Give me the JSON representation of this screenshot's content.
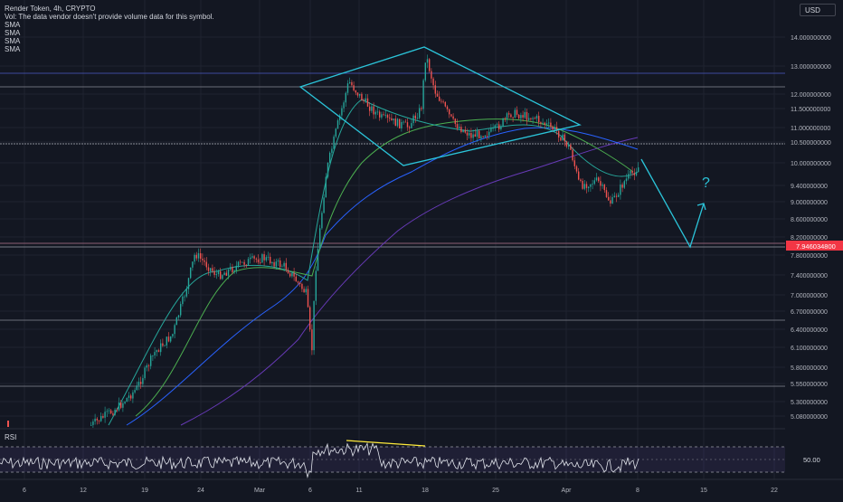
{
  "legend": {
    "title": "Render Token, 4h, CRYPTO",
    "vol_note": "Vol: The data vendor doesn't provide volume data for this symbol.",
    "sma_labels": [
      "SMA",
      "SMA",
      "SMA",
      "SMA"
    ]
  },
  "currency_button": "USD",
  "rsi_label": "RSI",
  "rsi_value_label": "50.00",
  "annotation_question": "?",
  "price_axis": {
    "ticks": [
      "14.000000000",
      "13.000000000",
      "12.000000000",
      "11.500000000",
      "11.000000000",
      "10.500000000",
      "10.000000000",
      "9.400000000",
      "9.000000000",
      "8.600000000",
      "8.200000000",
      "7.800000000",
      "7.400000000",
      "7.000000000",
      "6.700000000",
      "6.400000000",
      "6.100000000",
      "5.800000000",
      "5.550000000",
      "5.300000000",
      "5.080000000"
    ],
    "current_price_label": "7.946034800"
  },
  "time_axis": {
    "ticks": [
      "6",
      "12",
      "19",
      "24",
      "Mar",
      "6",
      "11",
      "18",
      "25",
      "Apr",
      "8",
      "15",
      "22"
    ]
  },
  "colors": {
    "background": "#131722",
    "up_candle": "#26a69a",
    "down_candle": "#ef5350",
    "drawing_cyan": "#2bc4d9",
    "sma_fast": "#4caf50",
    "sma_mid": "#2962ff",
    "sma_slow": "#673ab7",
    "rsi_line": "#e0e3eb",
    "divergence_line": "#ffeb3b",
    "price_label_bg": "#f23645"
  }
}
